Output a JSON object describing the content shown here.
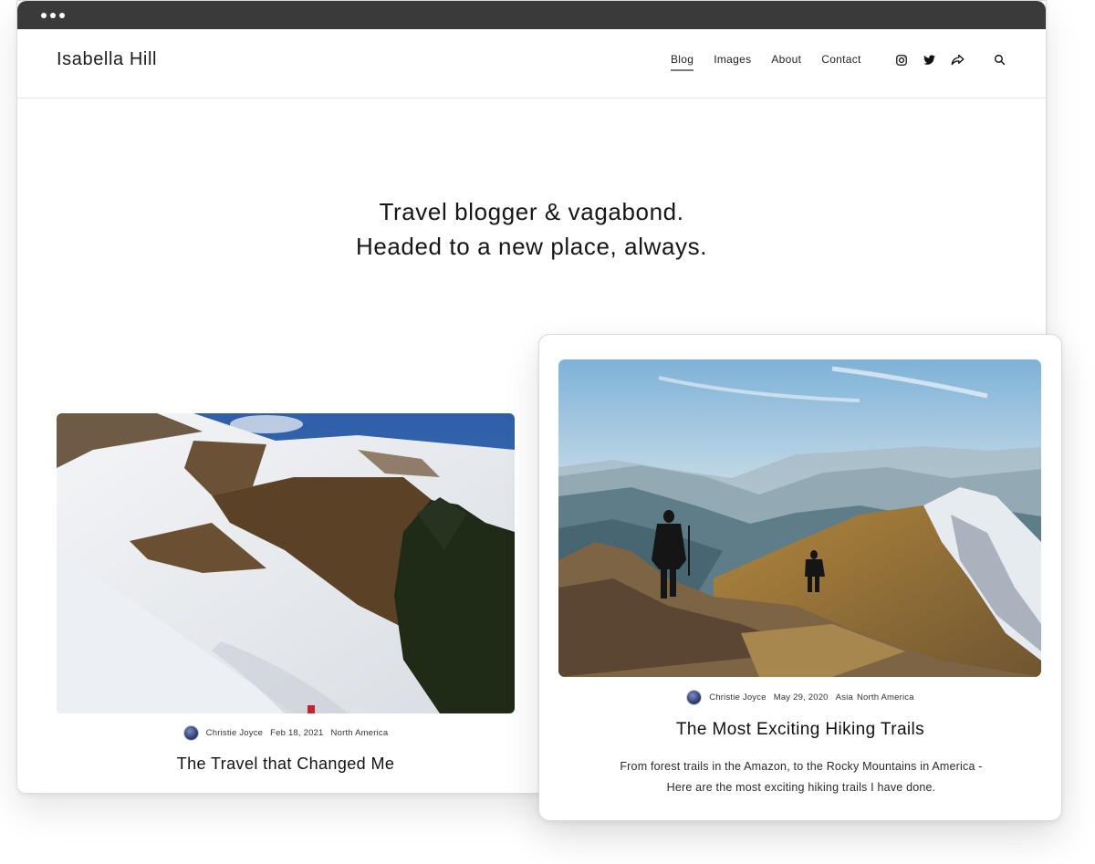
{
  "site": {
    "brand": "Isabella Hill",
    "nav": [
      {
        "label": "Blog",
        "active": true
      },
      {
        "label": "Images",
        "active": false
      },
      {
        "label": "About",
        "active": false
      },
      {
        "label": "Contact",
        "active": false
      }
    ],
    "social_icons": [
      "instagram-icon",
      "twitter-icon",
      "share-icon"
    ],
    "search_icon": "search-icon"
  },
  "hero": {
    "line1": "Travel blogger & vagabond.",
    "line2": "Headed to a new place, always."
  },
  "posts": [
    {
      "author": "Christie Joyce",
      "date": "Feb 18, 2021",
      "categories": [
        "North America"
      ],
      "title": "The Travel that Changed Me",
      "image": "snowy-hillside-photo"
    },
    {
      "author": "Christie Joyce",
      "date": "May 29, 2020",
      "categories": [
        "Asia",
        "North America"
      ],
      "title": "The Most Exciting Hiking Trails",
      "excerpt_line1": "From forest trails in the Amazon, to the Rocky Mountains in America -",
      "excerpt_line2": "Here are the most exciting hiking trails I have done.",
      "image": "mountain-hikers-photo"
    }
  ],
  "colors": {
    "titlebar": "#3a3a3a",
    "text": "#1a1a1a",
    "divider": "#e6e6e6"
  }
}
